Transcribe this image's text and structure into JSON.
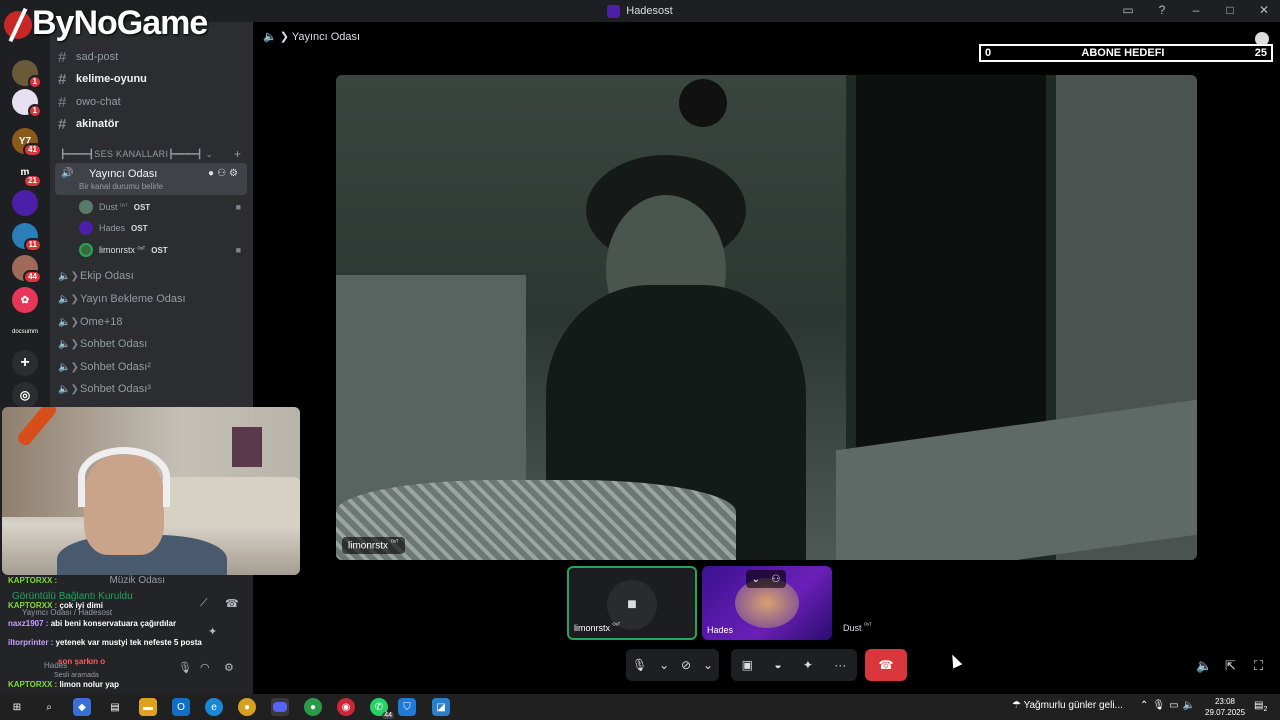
{
  "window": {
    "title": "Hadesost"
  },
  "watermark": {
    "text": "ByNoGame"
  },
  "servers": [
    {
      "badge": "1"
    },
    {
      "badge": "1"
    },
    {
      "label": "Y7",
      "badge": "41"
    },
    {
      "label": "m",
      "badge": "21"
    },
    {
      "badge": ""
    },
    {
      "badge": "11"
    },
    {
      "badge": "44"
    },
    {
      "badge": ""
    },
    {
      "label": "docsumm"
    }
  ],
  "channels": {
    "text": [
      "sad-post",
      "kelime-oyunu",
      "owo-chat",
      "akinatör"
    ],
    "category": "┣━━━━┫SES KANALLARI┣━━━━┫",
    "active": {
      "name": "Yayıncı Odası",
      "status": "Bir kanal durumu belirle"
    },
    "voice_users": [
      {
        "name": "Dust",
        "sup": "ᴼˢᵀ",
        "tag": "OST"
      },
      {
        "name": "Hades",
        "sup": "",
        "tag": "OST"
      },
      {
        "name": "limonrstx",
        "sup": "ᴼˢᵀ",
        "tag": "OST"
      }
    ],
    "voice": [
      "Ekip Odası",
      "Yayın Bekleme Odası",
      "Ome+18",
      "Sohbet Odası",
      "Sohbet Odası²",
      "Sohbet Odası³"
    ]
  },
  "chat": {
    "lines": [
      {
        "user": "KAPTORXX :",
        "text": "",
        "extra": "Müzik Odası"
      },
      {
        "user": "",
        "text": "Görüntülü Bağlantı Kuruldu",
        "extra": ""
      },
      {
        "user": "KAPTORXX :",
        "text": "çok iyi dimi",
        "extra": "Yayıncı Odası / Hadesost"
      },
      {
        "user": "naxz1907 :",
        "text": "abi beni konservatuara çağırdılar",
        "extra": ""
      },
      {
        "user": "iltorprinter :",
        "text": "yetenek var mustyi tek nefeste 5 posta",
        "extra": ""
      },
      {
        "user": "",
        "text": "son şarkın o",
        "extra": "Hades"
      },
      {
        "user": "",
        "text": "",
        "extra": "Sesli aramada"
      },
      {
        "user": "KAPTORXX :",
        "text": "limon nolur yap",
        "extra": ""
      }
    ]
  },
  "main": {
    "header": "Yayıncı Odası",
    "goal": {
      "left": "0",
      "title": "ABONE HEDEFI",
      "right": "25"
    },
    "video_label": "limonrstx",
    "video_label_sup": "ᴼˢᵀ",
    "tiles": [
      {
        "name": "limonrstx",
        "sup": "ᴼˢᵀ"
      },
      {
        "name": "Hades"
      }
    ],
    "dust_label": "Dust",
    "dust_sup": "ᴼˢᵀ"
  },
  "taskbar": {
    "weather": "Yağmurlu günler geli...",
    "time": "23:08",
    "date": "29.07.2025",
    "whatsapp_badge": "44",
    "notif_count": "2"
  },
  "colors": {
    "accent": "#5865f2",
    "danger": "#da373c",
    "online": "#23a55a",
    "bg": "#111214"
  }
}
